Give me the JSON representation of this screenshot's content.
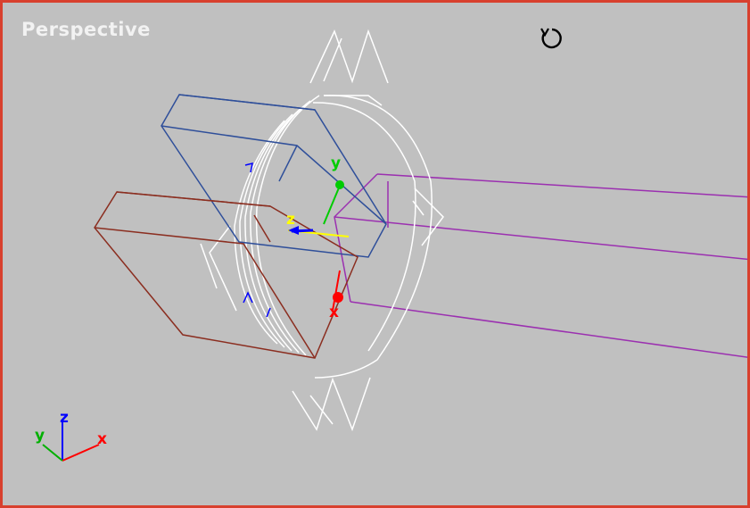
{
  "viewport": {
    "label": "Perspective",
    "background": "#c0c0c0",
    "border_color": "#d8402e"
  },
  "gizmo": {
    "x_label": "x",
    "y_label": "y",
    "z_label": "z",
    "x_color": "#ff0000",
    "y_color": "#00b000",
    "z_color": "#0000ff"
  },
  "colors": {
    "blue_box": "#2f4f9a",
    "red_box": "#8b2e20",
    "purple_box": "#9b30b0",
    "white_wire": "#ffffff",
    "pivot_z": "#0000ff",
    "pivot_x": "#ffff00",
    "pivot_y": "#00cc00"
  },
  "icons": {
    "orbit": "rotate-cursor-icon"
  }
}
